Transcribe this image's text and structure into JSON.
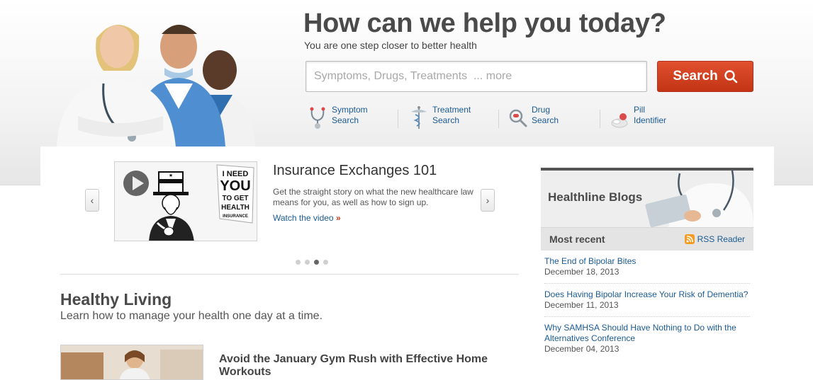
{
  "hero": {
    "title": "How can we help you today?",
    "subtitle": "You are one step closer to better health",
    "search_placeholder": "Symptoms, Drugs, Treatments  ... more",
    "search_button": "Search"
  },
  "quick_links": [
    {
      "line1": "Symptom",
      "line2": "Search",
      "icon": "stethoscope-icon"
    },
    {
      "line1": "Treatment",
      "line2": "Search",
      "icon": "caduceus-icon"
    },
    {
      "line1": "Drug",
      "line2": "Search",
      "icon": "magnifier-pill-icon"
    },
    {
      "line1": "Pill",
      "line2": "Identifier",
      "icon": "pill-icon"
    }
  ],
  "slider": {
    "title": "Insurance Exchanges 101",
    "description": "Get the straight story on what the new healthcare law means for you, as well as how to sign up.",
    "link": "Watch the video",
    "link_arrow": "»",
    "poster_lines": [
      "I NEED",
      "YOU",
      "TO GET",
      "HEALTH",
      "INSURANCE"
    ],
    "dots": 4,
    "active_dot": 3
  },
  "healthy_living": {
    "title": "Healthy Living",
    "subtitle": "Learn how to manage your health one day at a time.",
    "article_title": "Avoid the January Gym Rush with Effective Home Workouts"
  },
  "blog": {
    "title": "Healthline Blogs",
    "recent_label": "Most recent",
    "rss_label": "RSS Reader",
    "posts": [
      {
        "title": "The End of Bipolar Bites",
        "date": "December 18, 2013"
      },
      {
        "title": "Does Having Bipolar Increase Your Risk of Dementia?",
        "date": "December 11, 2013"
      },
      {
        "title": "Why SAMHSA Should Have Nothing to Do with the Alternatives Conference",
        "date": "December 04, 2013"
      }
    ]
  },
  "colors": {
    "accent": "#d0391b",
    "link": "#1a5a92",
    "heading": "#4a4a4a",
    "rss": "#f49b23"
  }
}
